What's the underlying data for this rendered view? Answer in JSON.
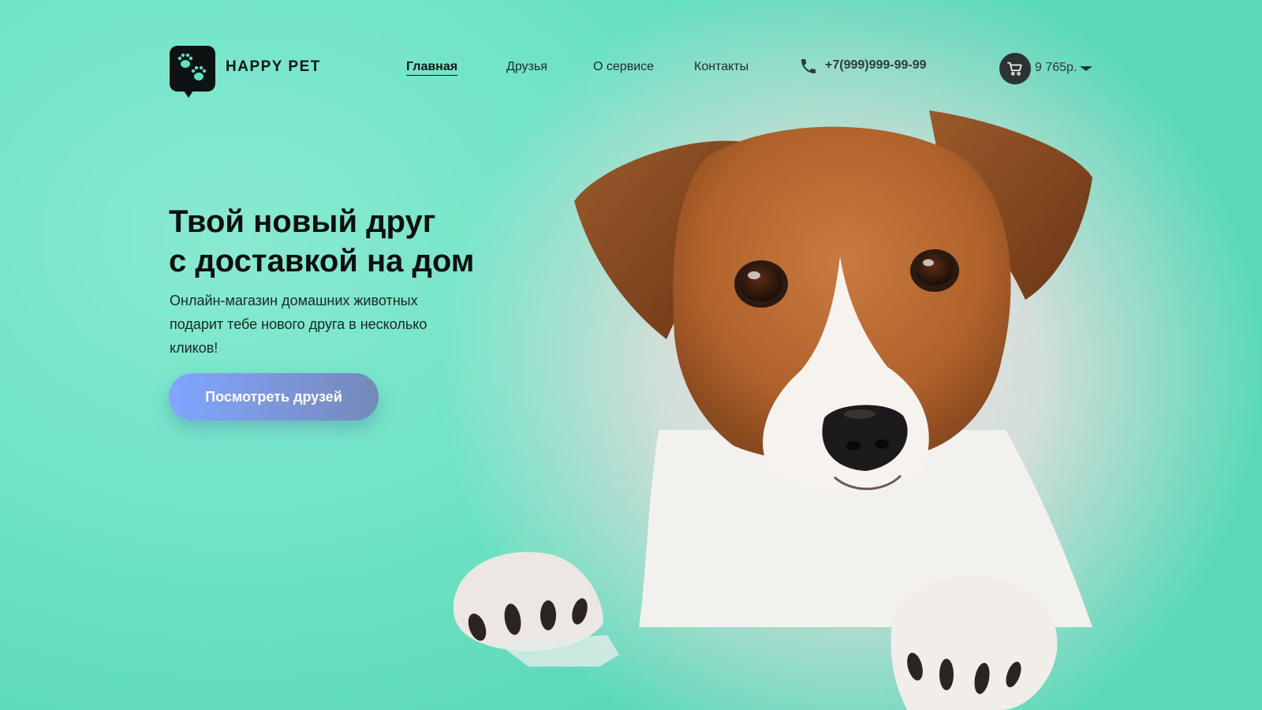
{
  "brand": {
    "name": "HAPPY PET",
    "logo_icon": "paw-prints-icon"
  },
  "nav": [
    {
      "label": "Главная",
      "active": true
    },
    {
      "label": "Друзья",
      "active": false
    },
    {
      "label": "О сервисе",
      "active": false
    },
    {
      "label": "Контакты",
      "active": false
    }
  ],
  "contact": {
    "phone": "+7(999)999-99-99",
    "icon": "phone-icon"
  },
  "cart": {
    "total": "9 765р.",
    "icon": "cart-icon"
  },
  "hero": {
    "title_line1": "Твой новый друг",
    "title_line2": "с доставкой на дом",
    "subtitle": "Онлайн-магазин домашних животных подарит тебе нового друга в несколько кликов!",
    "cta_label": "Посмотреть друзей"
  },
  "colors": {
    "background": "#6fe3c6",
    "accent_button": "#7fa6ff",
    "text": "#0b0f0e"
  }
}
